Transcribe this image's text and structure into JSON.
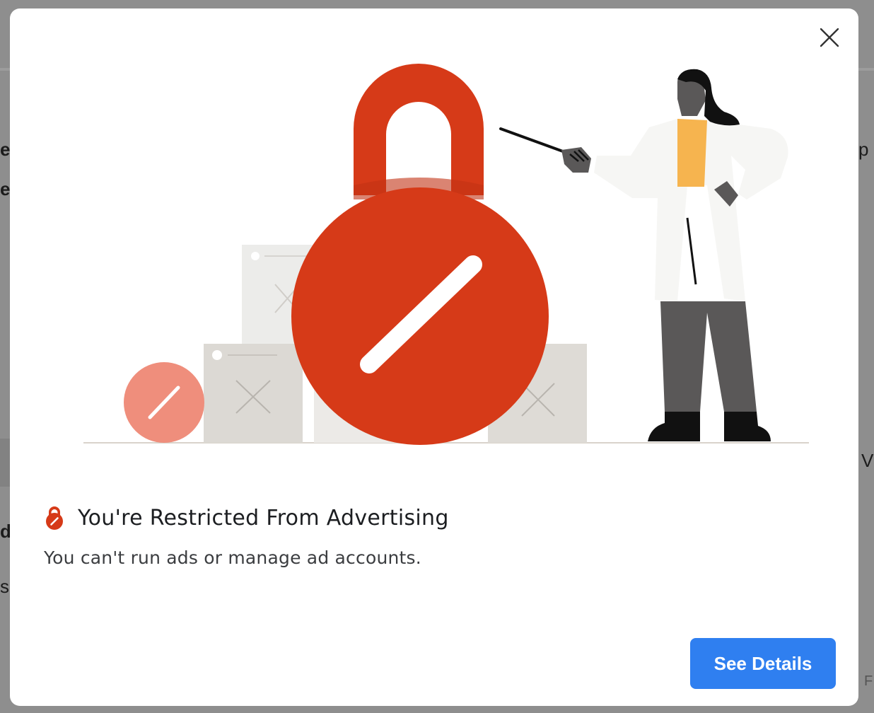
{
  "background_page": {
    "fragments_left": [
      "e",
      "e",
      "d",
      "s"
    ],
    "fragments_right": [
      "p",
      "V",
      "F"
    ]
  },
  "modal": {
    "title": "You're Restricted From Advertising",
    "description": "You can't run ads or manage ad accounts.",
    "see_details_label": "See Details",
    "title_icon": "lock-restricted-icon",
    "close_icon": "close-icon"
  },
  "colors": {
    "accent_blue": "#2f7ff0",
    "lock_red": "#d63a18",
    "lock_red_light": "#ef8e7c",
    "jacket_white": "#f6f6f4",
    "shirt_yellow": "#f6b44f"
  }
}
